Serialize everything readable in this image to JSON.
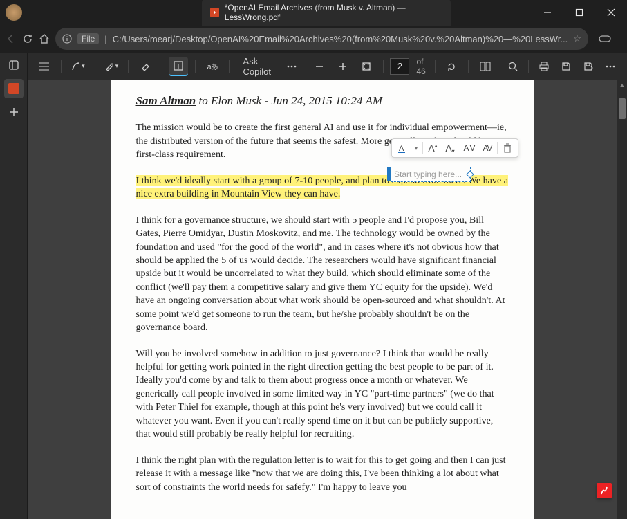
{
  "window": {
    "tab_title": "*OpenAI Email Archives (from Musk v. Altman) — LessWrong.pdf"
  },
  "urlbar": {
    "protocol_label": "File",
    "path": "C:/Users/mearj/Desktop/OpenAI%20Email%20Archives%20(from%20Musk%20v.%20Altman)%20—%20LessWr..."
  },
  "pdftoolbar": {
    "ask_copilot": "Ask Copilot",
    "page_current": "2",
    "page_total": "of 46"
  },
  "annotation": {
    "placeholder": "Start typing here..."
  },
  "document": {
    "from": "Sam Altman",
    "to_and_date": " to Elon Musk - Jun 24, 2015 10:24 AM",
    "p1": "The mission would be to create the first general AI and use it for individual empowerment—ie, the distributed version of the future that seems the safest. More generally, safety should be a first-class requirement.",
    "p2_hl": "I think we'd ideally start with a group of 7-10 people, and plan to expand from there. We have a nice extra building in Mountain View they can have.",
    "p3": "I think for a governance structure, we should start with 5 people and I'd propose you, Bill Gates, Pierre Omidyar, Dustin Moskovitz, and me. The technology would be owned by the foundation and used \"for the good of the world\", and in cases where it's not obvious how that should be applied the 5 of us would decide. The researchers would have significant financial upside but it would be uncorrelated to what they build, which should eliminate some of the conflict (we'll pay them a competitive salary and give them YC equity for the upside). We'd have an ongoing conversation about what work should be open-sourced and what shouldn't. At some point we'd get someone to run the team, but he/she probably shouldn't be on the governance board.",
    "p4": "Will you be involved somehow in addition to just governance? I think that would be really helpful for getting work pointed in the right direction getting the best people to be part of it. Ideally you'd come by and talk to them about progress once a month or whatever. We generically call people involved in some limited way in YC \"part-time partners\" (we do that with Peter Thiel for example, though at this point he's very involved) but we could call it whatever you want. Even if you can't really spend time on it but can be publicly supportive, that would still probably be really helpful for recruiting.",
    "p5": "I think the right plan with the regulation letter is to wait for this to get going and then I can just release it with a message like \"now that we are doing this, I've been thinking a lot about what sort of constraints the world needs for safefy.\" I'm happy to leave you"
  }
}
